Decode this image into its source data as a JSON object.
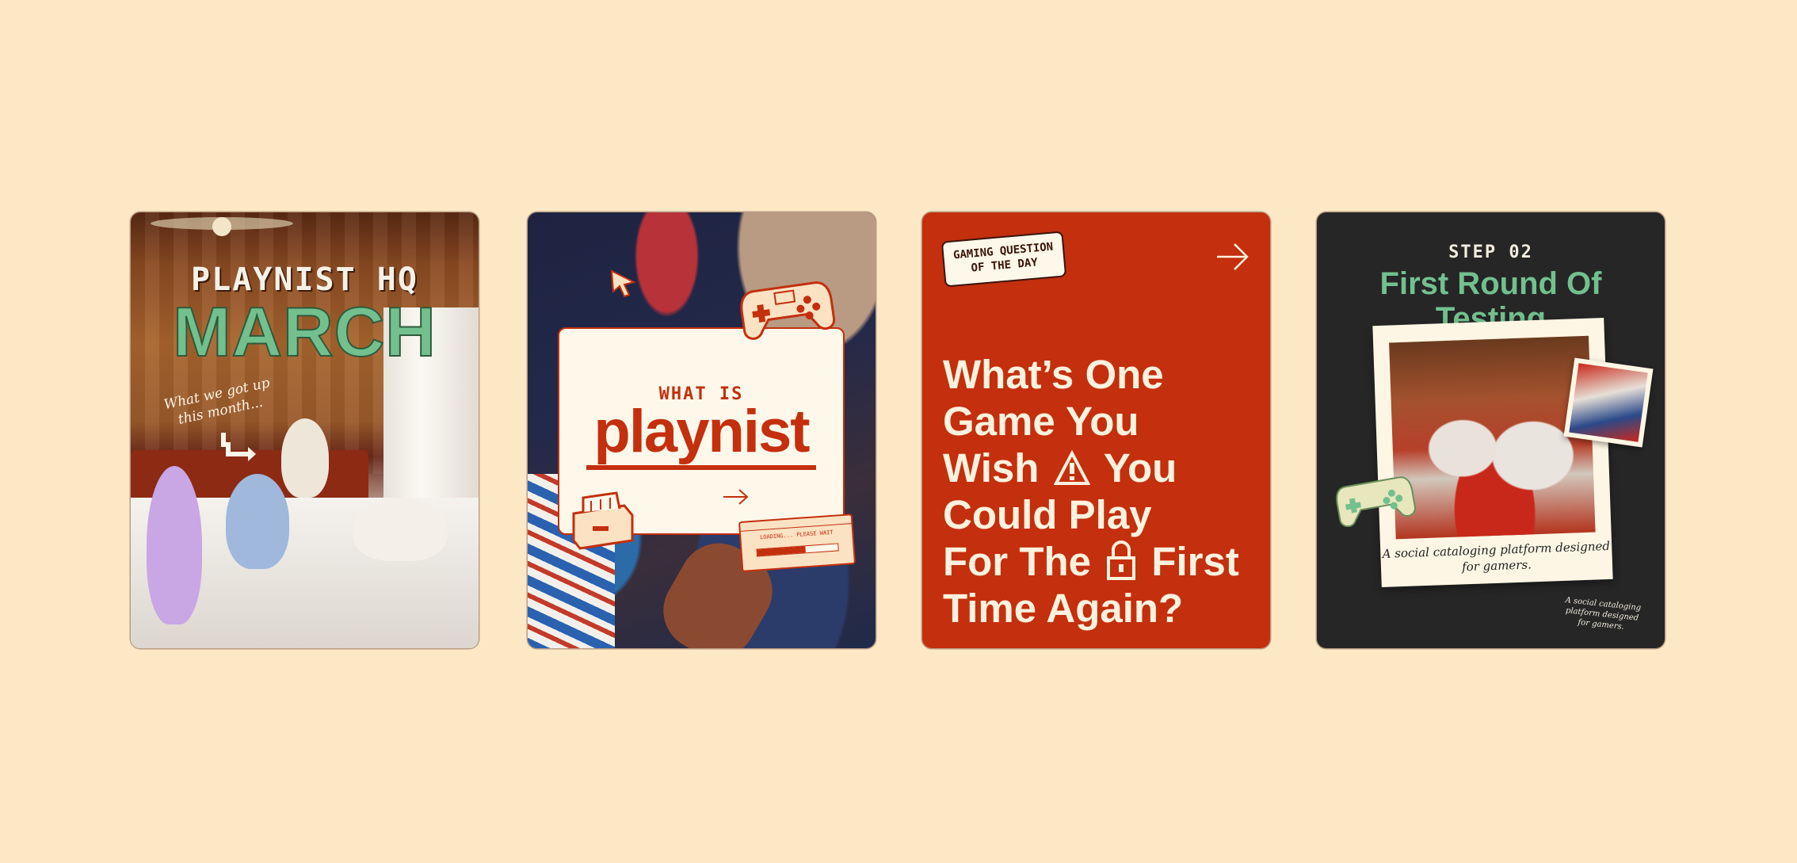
{
  "colors": {
    "background": "#fde8c6",
    "brand_red": "#c42f0e",
    "brand_green": "#72c08e",
    "dark": "#262626",
    "cream": "#fdf8ea"
  },
  "card1": {
    "title": "PLAYNIST HQ",
    "month": "MARCH",
    "subtitle": "What we got up this month..."
  },
  "card2": {
    "kicker": "WHAT IS",
    "brand": "playnist",
    "loading_text": "LOADING... PLEASE WAIT",
    "loading_progress": 0.6
  },
  "card3": {
    "tag_line1": "GAMING QUESTION",
    "tag_line2": "OF THE DAY",
    "q_line1": "What’s One",
    "q_line2": "Game You",
    "q_line3_a": "Wish",
    "q_line3_b": "You",
    "q_line4": "Could Play",
    "q_line5_a": "For The",
    "q_line5_b": "First",
    "q_line6": "Time Again?"
  },
  "card4": {
    "step": "STEP 02",
    "title_line1": "First Round Of",
    "title_line2": "Testing",
    "caption": "A social cataloging platform designed for gamers.",
    "small_caption": "A social cataloging platform designed for gamers."
  }
}
